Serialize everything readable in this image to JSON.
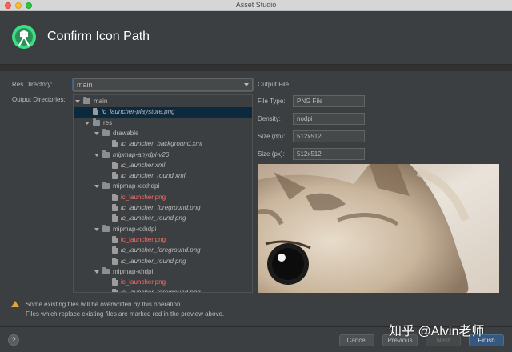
{
  "window": {
    "title": "Asset Studio"
  },
  "header": {
    "title": "Confirm Icon Path"
  },
  "res_directory": {
    "label": "Res Directory:",
    "value": "main"
  },
  "output_directories": {
    "label": "Output Directories:",
    "tree": [
      {
        "label": "main",
        "type": "folder",
        "level": 0,
        "expanded": true,
        "italic": false,
        "red": false,
        "selected": false
      },
      {
        "label": "ic_launcher-playstore.png",
        "type": "file",
        "level": 1,
        "italic": true,
        "red": false,
        "selected": true
      },
      {
        "label": "res",
        "type": "folder",
        "level": 1,
        "expanded": true,
        "italic": false,
        "red": false,
        "selected": false
      },
      {
        "label": "drawable",
        "type": "folder",
        "level": 2,
        "expanded": true,
        "italic": false,
        "red": false,
        "selected": false
      },
      {
        "label": "ic_launcher_background.xml",
        "type": "file",
        "level": 3,
        "italic": true,
        "red": false,
        "selected": false
      },
      {
        "label": "mipmap-anydpi-v26",
        "type": "folder",
        "level": 2,
        "expanded": true,
        "italic": true,
        "red": false,
        "selected": false
      },
      {
        "label": "ic_launcher.xml",
        "type": "file",
        "level": 3,
        "italic": true,
        "red": false,
        "selected": false
      },
      {
        "label": "ic_launcher_round.xml",
        "type": "file",
        "level": 3,
        "italic": true,
        "red": false,
        "selected": false
      },
      {
        "label": "mipmap-xxxhdpi",
        "type": "folder",
        "level": 2,
        "expanded": true,
        "italic": false,
        "red": false,
        "selected": false
      },
      {
        "label": "ic_launcher.png",
        "type": "file",
        "level": 3,
        "italic": false,
        "red": true,
        "selected": false
      },
      {
        "label": "ic_launcher_foreground.png",
        "type": "file",
        "level": 3,
        "italic": true,
        "red": false,
        "selected": false
      },
      {
        "label": "ic_launcher_round.png",
        "type": "file",
        "level": 3,
        "italic": true,
        "red": false,
        "selected": false
      },
      {
        "label": "mipmap-xxhdpi",
        "type": "folder",
        "level": 2,
        "expanded": true,
        "italic": false,
        "red": false,
        "selected": false
      },
      {
        "label": "ic_launcher.png",
        "type": "file",
        "level": 3,
        "italic": false,
        "red": true,
        "selected": false
      },
      {
        "label": "ic_launcher_foreground.png",
        "type": "file",
        "level": 3,
        "italic": true,
        "red": false,
        "selected": false
      },
      {
        "label": "ic_launcher_round.png",
        "type": "file",
        "level": 3,
        "italic": true,
        "red": false,
        "selected": false
      },
      {
        "label": "mipmap-xhdpi",
        "type": "folder",
        "level": 2,
        "expanded": true,
        "italic": false,
        "red": false,
        "selected": false
      },
      {
        "label": "ic_launcher.png",
        "type": "file",
        "level": 3,
        "italic": false,
        "red": true,
        "selected": false
      },
      {
        "label": "ic_launcher_foreground.png",
        "type": "file",
        "level": 3,
        "italic": true,
        "red": false,
        "selected": false
      }
    ]
  },
  "output_file": {
    "heading": "Output File",
    "file_type": {
      "label": "File Type:",
      "value": "PNG File"
    },
    "density": {
      "label": "Density:",
      "value": "nodpi"
    },
    "size_dp": {
      "label": "Size (dp):",
      "value": "512x512"
    },
    "size_px": {
      "label": "Size (px):",
      "value": "512x512"
    }
  },
  "warning": {
    "line1": "Some existing files will be overwritten by this operation.",
    "line2": "Files which replace existing files are marked red in the preview above."
  },
  "footer": {
    "help": "?",
    "cancel": "Cancel",
    "previous": "Previous",
    "next": "Next",
    "finish": "Finish"
  },
  "watermark": "知乎 @Alvin老师",
  "colors": {
    "accent": "#365880",
    "overwrite_red": "#ff6b68",
    "warning": "#e6a23c",
    "selection": "#0d293e"
  }
}
